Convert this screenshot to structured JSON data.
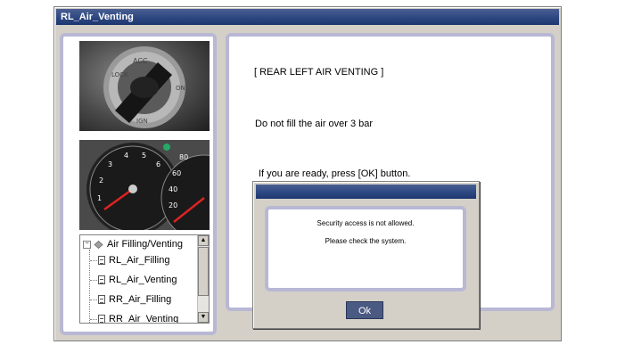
{
  "window": {
    "title": "RL_Air_Venting"
  },
  "main": {
    "header": "[ REAR LEFT AIR VENTING ]",
    "instruction": "Do not fill the air over 3 bar",
    "prompt": "If you are ready, press [OK] button."
  },
  "tree": {
    "root_label": "Air Filling/Venting",
    "expander": "−",
    "items": [
      {
        "label": "RL_Air_Filling"
      },
      {
        "label": "RL_Air_Venting"
      },
      {
        "label": "RR_Air_Filling"
      },
      {
        "label": "RR_Air_Venting"
      }
    ]
  },
  "dialog": {
    "line1": "Security access is not allowed.",
    "line2": "Please check the system.",
    "ok_label": "Ok"
  },
  "icons": {
    "expander": "minus-box-icon",
    "folder": "diamond-folder-icon",
    "document": "document-icon"
  },
  "colors": {
    "titlebar": "#2f4a83",
    "panel_border": "#b8b8d4",
    "ok_button": "#4a5a82",
    "window_bg": "#d4d0c8"
  }
}
